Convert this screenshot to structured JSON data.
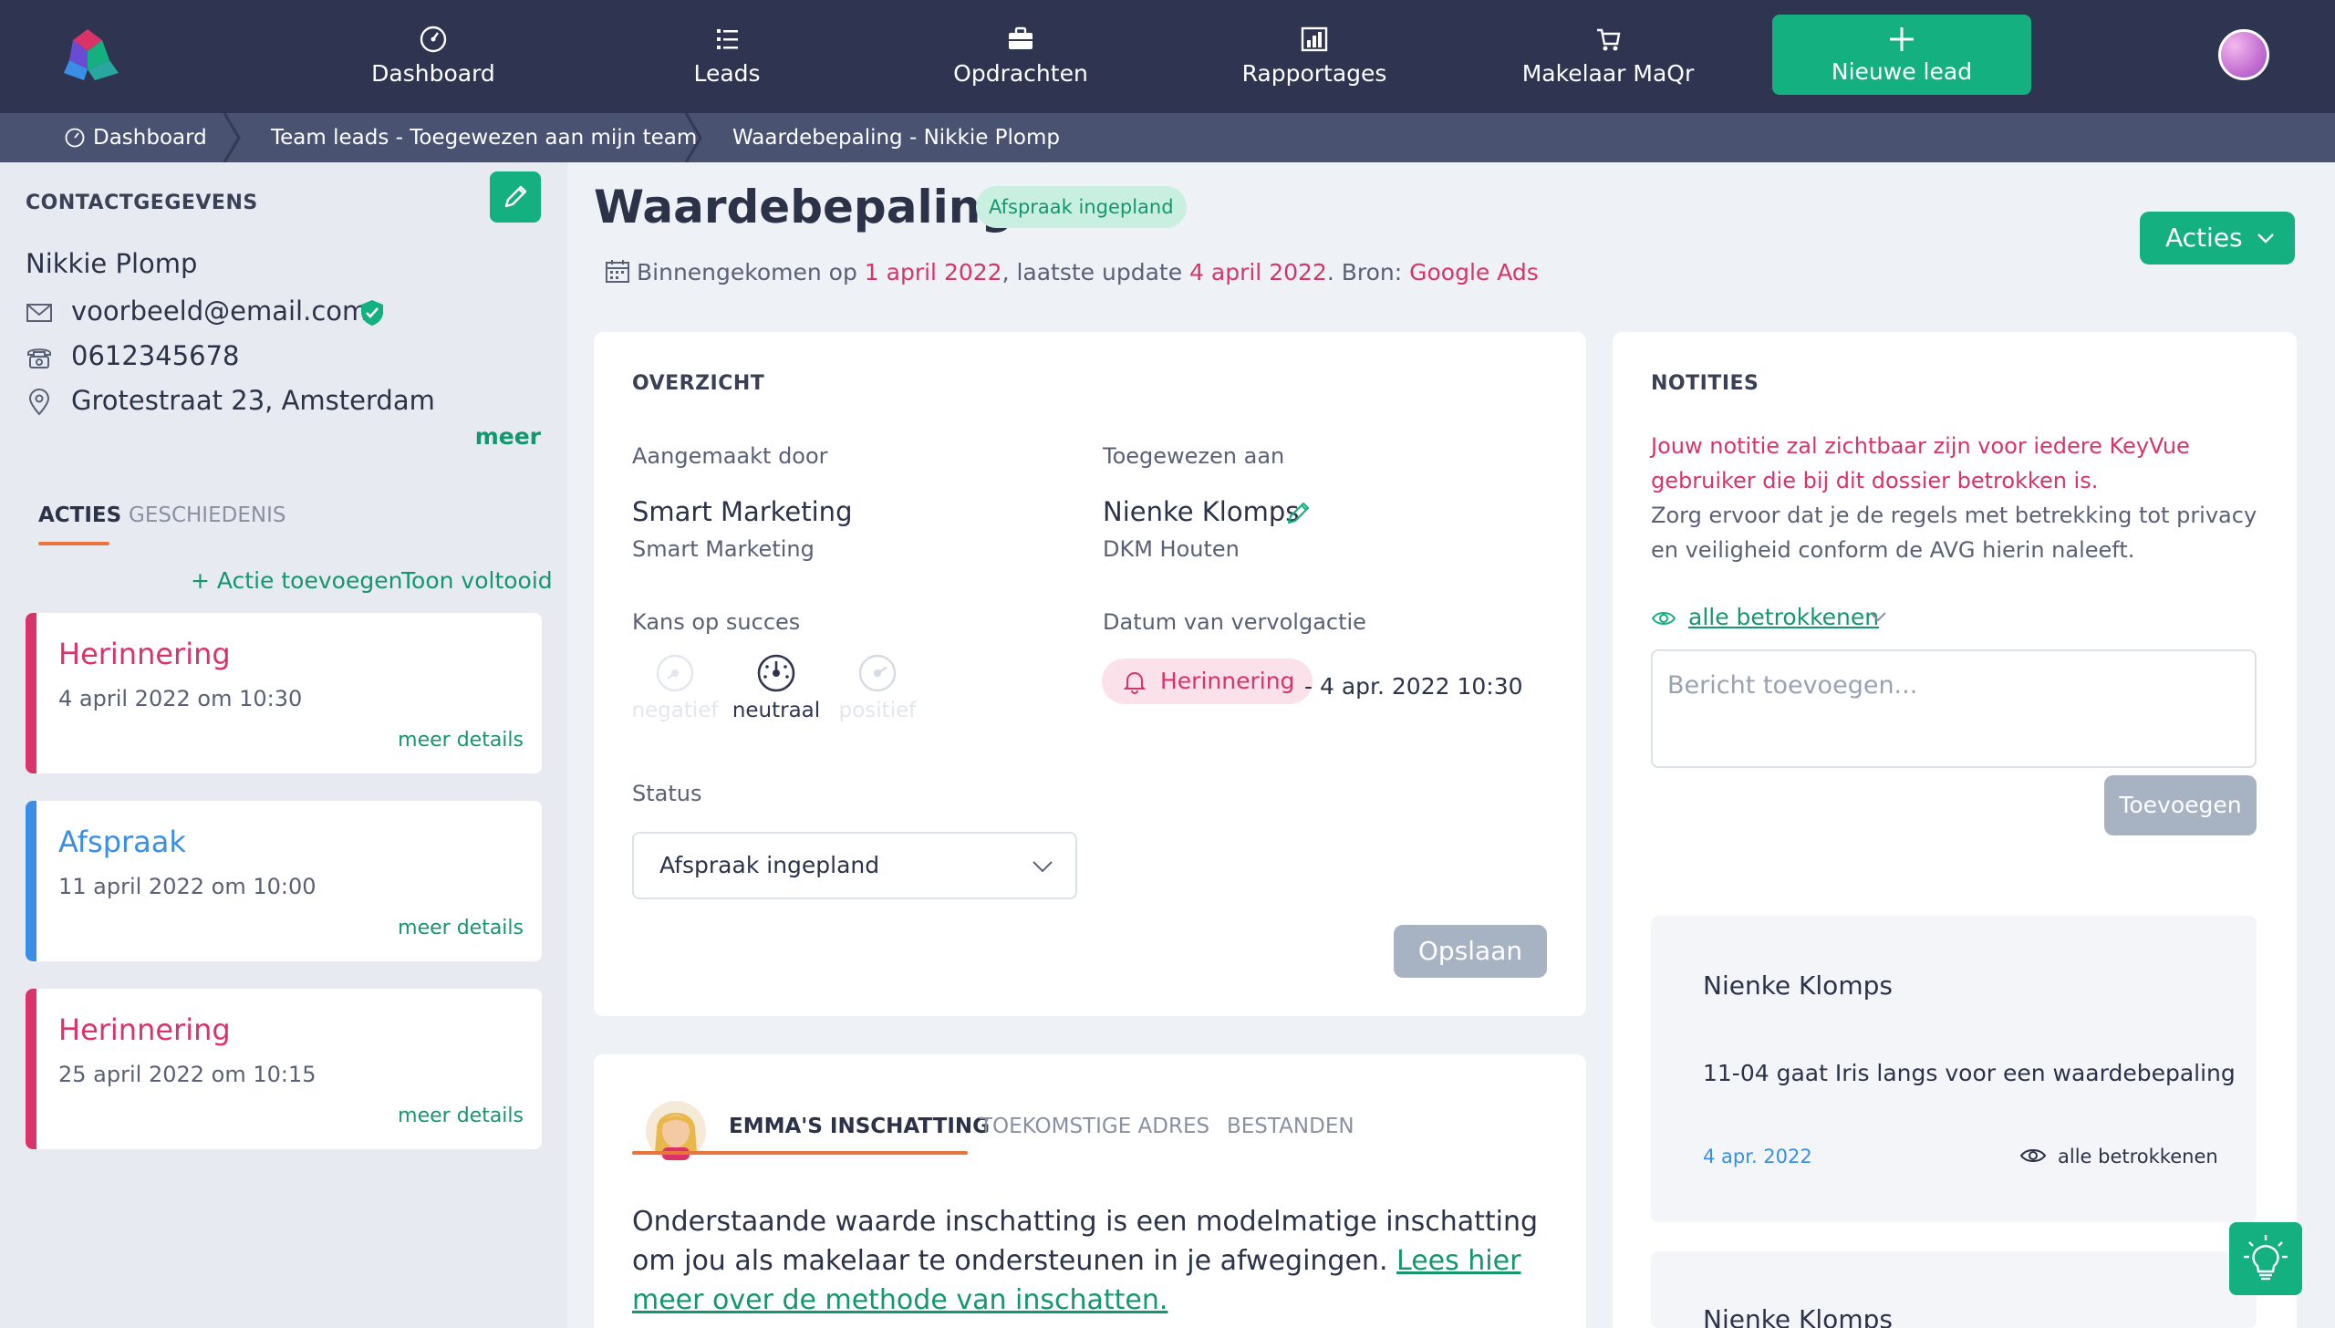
{
  "nav": {
    "items": [
      {
        "label": "Dashboard",
        "icon": "dashboard-icon"
      },
      {
        "label": "Leads",
        "icon": "list-icon"
      },
      {
        "label": "Opdrachten",
        "icon": "briefcase-icon"
      },
      {
        "label": "Rapportages",
        "icon": "chart-icon"
      },
      {
        "label": "Makelaar MaQr",
        "icon": "cart-icon"
      }
    ],
    "new_lead": "Nieuwe lead",
    "brand_color": "#2f3550",
    "accent_color": "#14b07f"
  },
  "breadcrumb": [
    "Dashboard",
    "Team leads - Toegewezen aan mijn team",
    "Waardebepaling - Nikkie Plomp"
  ],
  "contact": {
    "heading": "CONTACTGEGEVENS",
    "name": "Nikkie Plomp",
    "email": "voorbeeld@email.com",
    "phone": "0612345678",
    "address": "Grotestraat 23, Amsterdam",
    "more": "meer"
  },
  "sidebar_tabs": {
    "active": "ACTIES",
    "inactive": "GESCHIEDENIS"
  },
  "actions_links": {
    "add": "+ Actie toevoegen",
    "show_done": "Toon voltooid"
  },
  "action_cards": [
    {
      "title": "Herinnering",
      "date": "4 april 2022 om 10:30",
      "link": "meer details",
      "color": "#d9336a"
    },
    {
      "title": "Afspraak",
      "date": "11 april 2022 om 10:00",
      "link": "meer details",
      "color": "#3a8ee6"
    },
    {
      "title": "Herinnering",
      "date": "25 april 2022 om 10:15",
      "link": "meer details",
      "color": "#d9336a"
    }
  ],
  "header": {
    "title": "Waardebepaling",
    "badge": "Afspraak ingepland",
    "meta_1": "Binnengekomen op ",
    "received": "1 april 2022",
    "meta_2": ", laatste update ",
    "updated": "4 april 2022",
    "meta_3": ". Bron: ",
    "source": "Google Ads",
    "acties": "Acties"
  },
  "overview": {
    "heading": "OVERZICHT",
    "created_label": "Aangemaakt door",
    "created_by": "Smart Marketing",
    "created_org": "Smart Marketing",
    "assigned_label": "Toegewezen aan",
    "assigned_to": "Nienke Klomps",
    "assigned_org": "DKM Houten",
    "chance_label": "Kans op succes",
    "chance_options": [
      "negatief",
      "neutraal",
      "positief"
    ],
    "chance_selected": "neutraal",
    "followup_label": "Datum van vervolgactie",
    "followup_badge": "Herinnering",
    "followup_date": "- 4 apr. 2022 10:30",
    "status_label": "Status",
    "status_value": "Afspraak ingepland",
    "save": "Opslaan"
  },
  "valuation": {
    "tabs": [
      "EMMA'S INSCHATTING",
      "TOEKOMSTIGE ADRES",
      "BESTANDEN"
    ],
    "text": "Onderstaande waarde inschatting is een modelmatige inschatting om jou als makelaar te ondersteunen in je afwegingen. ",
    "link": "Lees hier meer over de methode van inschatten."
  },
  "notes": {
    "heading": "NOTITIES",
    "warning": "Jouw notitie zal zichtbaar zijn voor iedere KeyVue gebruiker die bij dit dossier betrokken is.",
    "info": "Zorg ervoor dat je de regels met betrekking tot privacy en veiligheid conform de AVG hierin naleeft.",
    "visibility": "alle betrokkenen",
    "placeholder": "Bericht toevoegen...",
    "add": "Toevoegen",
    "items": [
      {
        "author": "Nienke Klomps",
        "text": "11-04 gaat Iris langs voor een waardebepaling",
        "date": "4 apr. 2022",
        "visibility": "alle betrokkenen"
      },
      {
        "author": "Nienke Klomps"
      }
    ]
  }
}
